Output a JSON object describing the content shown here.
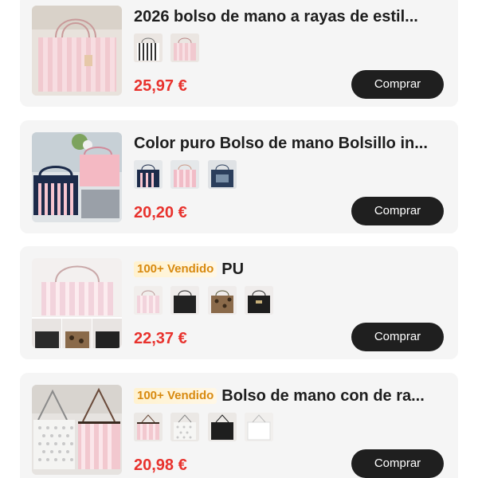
{
  "products": [
    {
      "title": "2026 bolso de mano a rayas de estil...",
      "badge": "",
      "price": "25,97 €",
      "buy_label": "Comprar",
      "swatch_count": 2
    },
    {
      "title": "Color puro Bolso de mano Bolsillo in...",
      "badge": "",
      "price": "20,20 €",
      "buy_label": "Comprar",
      "swatch_count": 3
    },
    {
      "title": "PU",
      "badge": "100+ Vendido",
      "price": "22,37 €",
      "buy_label": "Comprar",
      "swatch_count": 4
    },
    {
      "title": "Bolso de mano con de ra...",
      "badge": "100+ Vendido",
      "price": "20,98 €",
      "buy_label": "Comprar",
      "swatch_count": 4
    }
  ],
  "colors": {
    "price": "#e8322d",
    "button_bg": "#1f1f1f",
    "badge_text": "#d88a10",
    "card_bg": "#f5f5f5"
  }
}
